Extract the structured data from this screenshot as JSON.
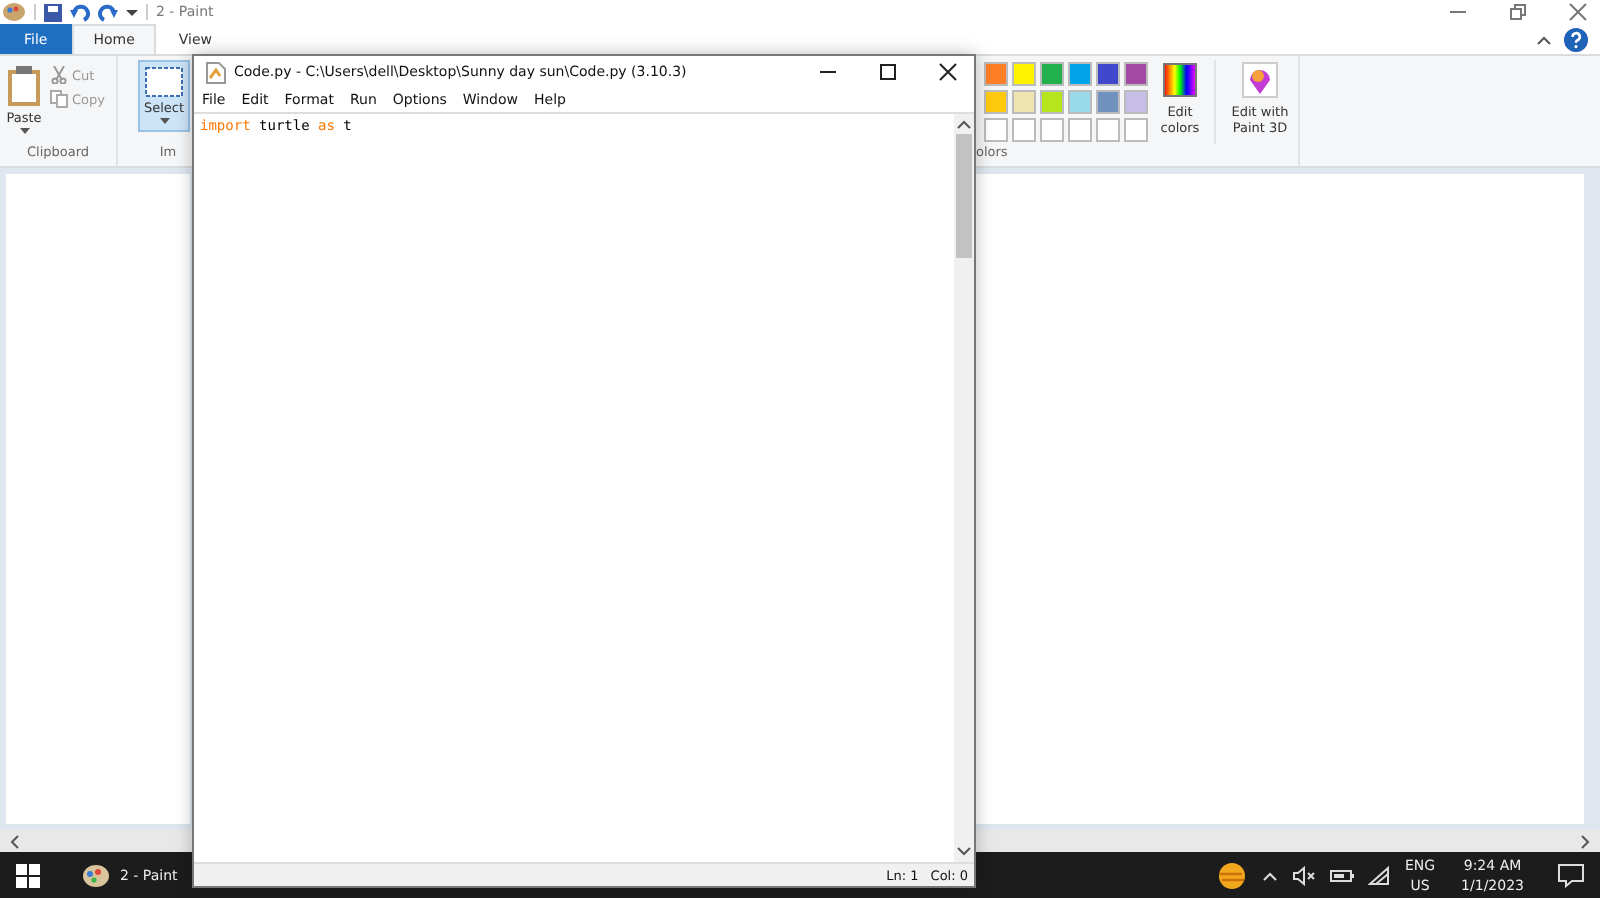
{
  "paint": {
    "title": "2 - Paint",
    "tabs": [
      {
        "label": "File",
        "kind": "file",
        "selected": false
      },
      {
        "label": "Home",
        "kind": "tab",
        "selected": true
      },
      {
        "label": "View",
        "kind": "tab",
        "selected": false
      }
    ],
    "clipboard": {
      "paste": "Paste",
      "cut": "Cut",
      "copy": "Copy",
      "group": "Clipboard"
    },
    "select": {
      "label": "Select",
      "group": "Im"
    },
    "colors_group": "olors",
    "palette": [
      {
        "row": [
          {
            "color": "#ff7f27"
          },
          {
            "color": "#fff200"
          },
          {
            "color": "#22b14c"
          },
          {
            "color": "#00a2e8"
          },
          {
            "color": "#3f48cc"
          },
          {
            "color": "#a349a4"
          }
        ]
      },
      {
        "row": [
          {
            "color": "#ffc90e"
          },
          {
            "color": "#efe4b0"
          },
          {
            "color": "#b5e61d"
          },
          {
            "color": "#99d9ea"
          },
          {
            "color": "#7092be"
          },
          {
            "color": "#c8bfe7"
          }
        ]
      },
      {
        "row": [
          {
            "color": "#ffffff"
          },
          {
            "color": "#ffffff"
          },
          {
            "color": "#ffffff"
          },
          {
            "color": "#ffffff"
          },
          {
            "color": "#ffffff"
          },
          {
            "color": "#ffffff"
          }
        ]
      }
    ],
    "edit_colors": "Edit colors",
    "edit_3d": "Edit with Paint 3D"
  },
  "idle": {
    "title": "Code.py - C:\\Users\\dell\\Desktop\\Sunny day sun\\Code.py (3.10.3)",
    "menu": [
      "File",
      "Edit",
      "Format",
      "Run",
      "Options",
      "Window",
      "Help"
    ],
    "code_lines": [
      {
        "tokens": [
          {
            "text": "import",
            "kind": "keyword"
          },
          {
            "text": " turtle ",
            "kind": "plain"
          },
          {
            "text": "as",
            "kind": "keyword"
          },
          {
            "text": " t",
            "kind": "plain"
          }
        ]
      }
    ],
    "status": [
      "Ln: 1",
      "Col: 0"
    ]
  },
  "taskbar": {
    "app": "2 - Paint",
    "lang": "ENG",
    "region": "US",
    "time": "9:24 AM",
    "date": "1/1/2023"
  }
}
